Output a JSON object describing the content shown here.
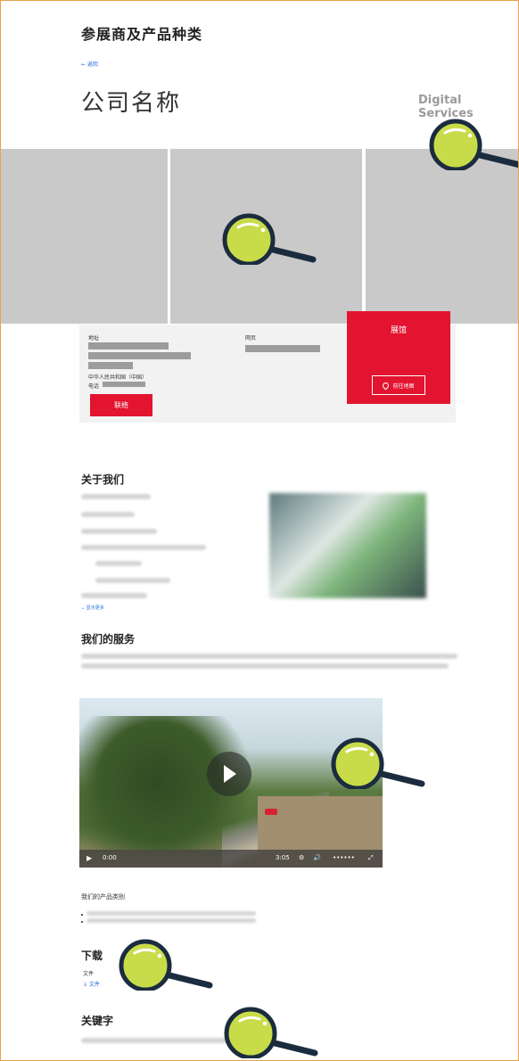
{
  "page": {
    "top_title": "参展商及产品种类",
    "back_link": "← 返回",
    "company_name": "公司名称",
    "digital_services": "Digital Services"
  },
  "info": {
    "address_label": "地址",
    "website_label": "网页",
    "country_line": "中华人民共和国（中国）",
    "phone_label": "电话",
    "contact_button": "联络"
  },
  "hall": {
    "title": "展馆",
    "map_button": "前往地图"
  },
  "sections": {
    "about_title": "关于我们",
    "show_more": "⌄ 显示更多",
    "services_title": "我们的服务",
    "product_category": "我们的产品类别",
    "download_title": "下载",
    "download_label": "文件",
    "download_link": "↓ 文件",
    "keywords_title": "关键字"
  },
  "video": {
    "time_current": "0:00",
    "time_total": "3:05",
    "volume_dots": "••••••",
    "icons": [
      "play-icon",
      "settings-icon",
      "volume-icon",
      "fullscreen-icon"
    ]
  },
  "colors": {
    "accent_red": "#e3142f",
    "panel_gray": "#c9c9c9",
    "magnifier_lens": "#c8dc4a",
    "magnifier_dark": "#1b2c3f"
  }
}
